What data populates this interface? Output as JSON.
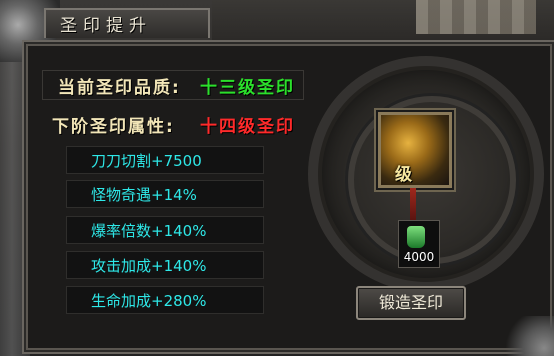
{
  "window": {
    "title": "圣印提升"
  },
  "current_quality": {
    "label": "当前圣印品质:",
    "value": "十三级圣印"
  },
  "next_attributes": {
    "label": "下阶圣印属性:",
    "value": "十四级圣印",
    "items": [
      "刀刀切割+7500",
      "怪物奇遇+14%",
      "爆率倍数+140%",
      "攻击加成+140%",
      "生命加成+280%"
    ]
  },
  "seal": {
    "level_text": "级"
  },
  "material": {
    "count": "4000",
    "icon": "green-potion-icon"
  },
  "forge_button": {
    "label": "锻造圣印"
  },
  "colors": {
    "label": "#f2e6b8",
    "green": "#2be02b",
    "red": "#ff2a2a",
    "cyan": "#2ee8e8"
  }
}
